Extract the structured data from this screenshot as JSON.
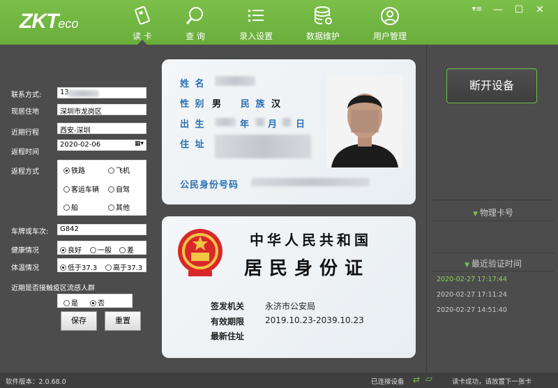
{
  "brand": {
    "logo_main": "ZKT",
    "logo_sub": "eco"
  },
  "nav": [
    {
      "label": "读 卡",
      "icon": "card-reader-icon"
    },
    {
      "label": "查 询",
      "icon": "search-icon"
    },
    {
      "label": "录入设置",
      "icon": "list-settings-icon"
    },
    {
      "label": "数据维护",
      "icon": "database-icon"
    },
    {
      "label": "用户管理",
      "icon": "user-icon"
    }
  ],
  "window_controls": {
    "menu": "▾≡",
    "minimize": "—",
    "maximize": "☐",
    "close": "✕"
  },
  "form": {
    "contact_label": "联系方式:",
    "contact_value": "13",
    "residence_label": "现居住地",
    "residence_value": "深圳市龙岗区",
    "itinerary_label": "近期行程",
    "itinerary_value": "西安-深圳",
    "return_time_label": "返程时间",
    "return_time_value": "2020-02-06",
    "return_method_label": "返程方式",
    "methods": [
      "铁路",
      "飞机",
      "客运车辆",
      "自驾",
      "船",
      "其他"
    ],
    "method_selected": "铁路",
    "plate_label": "车牌或车次:",
    "plate_value": "G842",
    "health_label": "健康情况",
    "health_options": [
      "良好",
      "一般",
      "差"
    ],
    "health_selected": "良好",
    "temp_label": "体温情况",
    "temp_options": [
      "低于37.3",
      "高于37.3"
    ],
    "temp_selected": "低于37.3",
    "contact_epi_label": "近期是否接触疫区流感人群",
    "contact_epi_options": [
      "是",
      "否"
    ],
    "contact_epi_selected": "否",
    "save_label": "保存",
    "reset_label": "重置"
  },
  "id_front": {
    "name_label": "姓 名",
    "gender_label": "性 别",
    "gender_value": "男",
    "ethnic_label": "民 族",
    "ethnic_value": "汉",
    "birth_label": "出 生",
    "year": "年",
    "month": "月",
    "day": "日",
    "address_label": "住 址",
    "id_label": "公民身份号码"
  },
  "id_back": {
    "title1": "中华人民共和国",
    "title2": "居民身份证",
    "issuer_label": "签发机关",
    "issuer_value": "永济市公安局",
    "validity_label": "有效期限",
    "validity_value": "2019.10.23-2039.10.23",
    "newaddr_label": "最新住址"
  },
  "right": {
    "disconnect_label": "断开设备",
    "card_no_label": "物理卡号",
    "recent_label": "最近验证时间",
    "records": [
      "2020-02-27 17:17:44",
      "2020-02-27 17:11:24",
      "2020-02-27 14:51:40"
    ],
    "accent": "#7cc04a"
  },
  "status": {
    "version": "软件版本：2.0.68.0",
    "connected": "已连接设备",
    "message": "读卡成功，请放置下一张卡"
  }
}
